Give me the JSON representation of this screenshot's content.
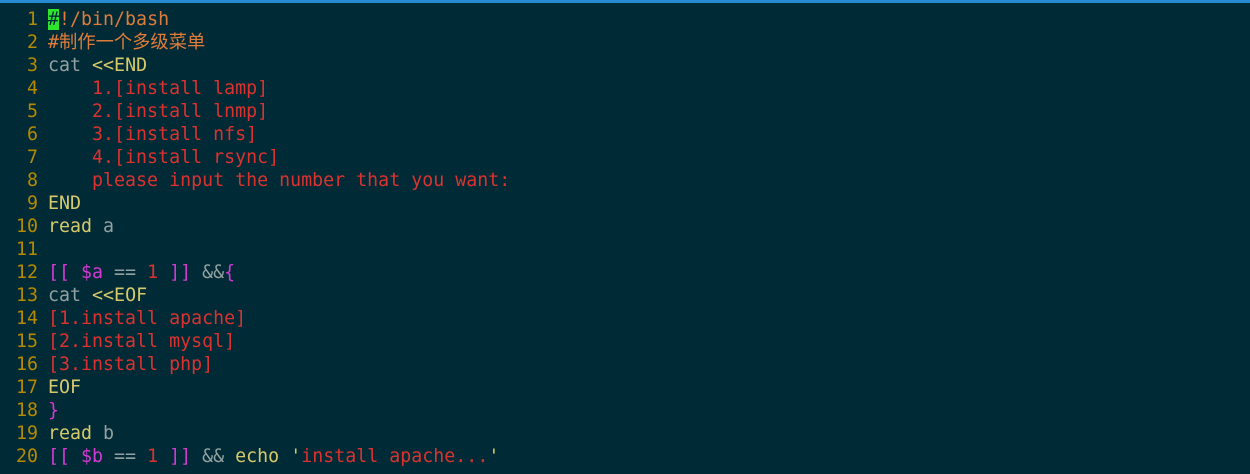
{
  "colors": {
    "background": "#002b36",
    "line_number": "#b58900",
    "comment": "#e07b39",
    "command": "#b5b576",
    "keyword_yellow": "#d6c96b",
    "plain": "#93a1a1",
    "heredoc_text": "#dc322f",
    "bracket_magenta": "#d33ad3",
    "cursor": "#2ee52e"
  },
  "editor": {
    "lines": [
      {
        "number": "1",
        "segments": [
          {
            "text": "#",
            "color": "#002b36",
            "cursor": true
          },
          {
            "text": "!/bin/bash",
            "color": "#e07b39"
          }
        ]
      },
      {
        "number": "2",
        "segments": [
          {
            "text": "#制作一个多级菜单",
            "color": "#e07b39"
          }
        ]
      },
      {
        "number": "3",
        "segments": [
          {
            "text": "cat",
            "color": "#93a1a1"
          },
          {
            "text": " ",
            "color": "#93a1a1"
          },
          {
            "text": "<<END",
            "color": "#d6c96b"
          }
        ]
      },
      {
        "number": "4",
        "segments": [
          {
            "text": "    1.[install lamp]",
            "color": "#dc322f"
          }
        ]
      },
      {
        "number": "5",
        "segments": [
          {
            "text": "    2.[install lnmp]",
            "color": "#dc322f"
          }
        ]
      },
      {
        "number": "6",
        "segments": [
          {
            "text": "    3.[install nfs]",
            "color": "#dc322f"
          }
        ]
      },
      {
        "number": "7",
        "segments": [
          {
            "text": "    4.[install rsync]",
            "color": "#dc322f"
          }
        ]
      },
      {
        "number": "8",
        "segments": [
          {
            "text": "    please input the number that you want:",
            "color": "#dc322f"
          }
        ]
      },
      {
        "number": "9",
        "segments": [
          {
            "text": "END",
            "color": "#d6c96b"
          }
        ]
      },
      {
        "number": "10",
        "segments": [
          {
            "text": "read",
            "color": "#d6c96b"
          },
          {
            "text": " a",
            "color": "#93a1a1"
          }
        ]
      },
      {
        "number": "11",
        "segments": []
      },
      {
        "number": "12",
        "segments": [
          {
            "text": "[[",
            "color": "#d33ad3"
          },
          {
            "text": " ",
            "color": "#93a1a1"
          },
          {
            "text": "$a",
            "color": "#d33ad3"
          },
          {
            "text": " == ",
            "color": "#93a1a1"
          },
          {
            "text": "1",
            "color": "#dc322f"
          },
          {
            "text": " ",
            "color": "#93a1a1"
          },
          {
            "text": "]]",
            "color": "#d33ad3"
          },
          {
            "text": " &&",
            "color": "#93a1a1"
          },
          {
            "text": "{",
            "color": "#d33ad3"
          }
        ]
      },
      {
        "number": "13",
        "segments": [
          {
            "text": "cat",
            "color": "#93a1a1"
          },
          {
            "text": " ",
            "color": "#93a1a1"
          },
          {
            "text": "<<EOF",
            "color": "#d6c96b"
          }
        ]
      },
      {
        "number": "14",
        "segments": [
          {
            "text": "[1.install apache]",
            "color": "#dc322f"
          }
        ]
      },
      {
        "number": "15",
        "segments": [
          {
            "text": "[2.install mysql]",
            "color": "#dc322f"
          }
        ]
      },
      {
        "number": "16",
        "segments": [
          {
            "text": "[3.install php]",
            "color": "#dc322f"
          }
        ]
      },
      {
        "number": "17",
        "segments": [
          {
            "text": "EOF",
            "color": "#d6c96b"
          }
        ]
      },
      {
        "number": "18",
        "segments": [
          {
            "text": "}",
            "color": "#d33ad3"
          }
        ]
      },
      {
        "number": "19",
        "segments": [
          {
            "text": "read",
            "color": "#d6c96b"
          },
          {
            "text": " b",
            "color": "#93a1a1"
          }
        ]
      },
      {
        "number": "20",
        "segments": [
          {
            "text": "[[",
            "color": "#d33ad3"
          },
          {
            "text": " ",
            "color": "#93a1a1"
          },
          {
            "text": "$b",
            "color": "#d33ad3"
          },
          {
            "text": " == ",
            "color": "#93a1a1"
          },
          {
            "text": "1",
            "color": "#dc322f"
          },
          {
            "text": " ",
            "color": "#93a1a1"
          },
          {
            "text": "]]",
            "color": "#d33ad3"
          },
          {
            "text": " && ",
            "color": "#93a1a1"
          },
          {
            "text": "echo",
            "color": "#d6c96b"
          },
          {
            "text": " ",
            "color": "#93a1a1"
          },
          {
            "text": "'",
            "color": "#d6c96b"
          },
          {
            "text": "install apache...",
            "color": "#dc322f"
          },
          {
            "text": "'",
            "color": "#d6c96b"
          }
        ]
      }
    ]
  }
}
